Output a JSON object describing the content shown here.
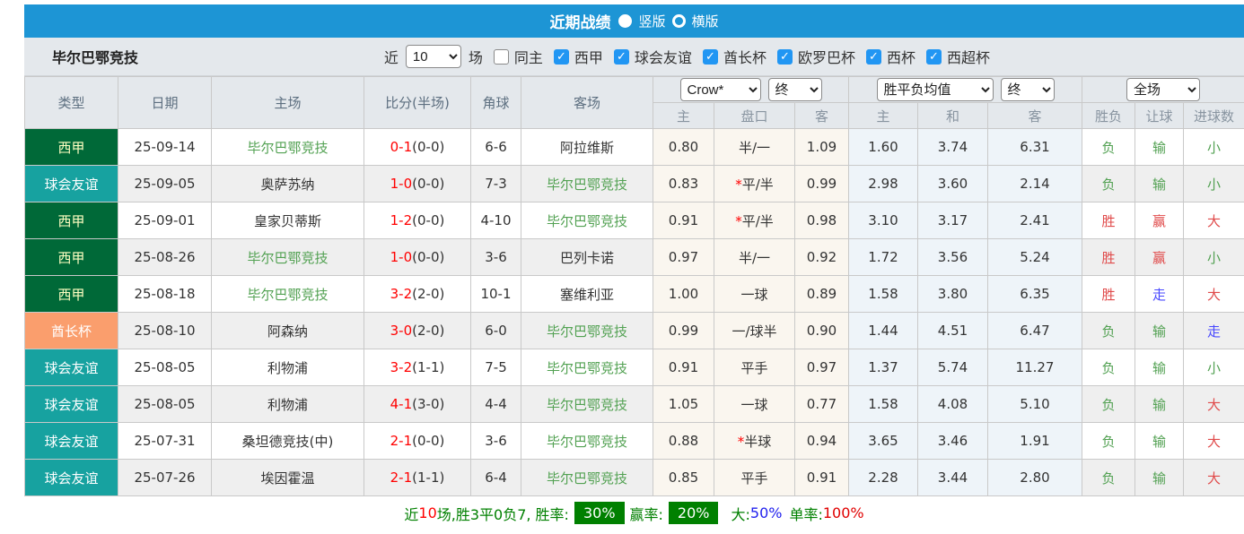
{
  "title_bar": {
    "title": "近期战绩",
    "radio_vertical_label": "竖版",
    "radio_horizontal_label": "横版",
    "selected": "竖版"
  },
  "filter": {
    "team": "毕尔巴鄂竞技",
    "near_label": "近",
    "count_value": "10",
    "games_label": "场",
    "same_home_label": "同主",
    "leagues": [
      "西甲",
      "球会友谊",
      "酋长杯",
      "欧罗巴杯",
      "西杯",
      "西超杯"
    ],
    "leagues_checked": [
      true,
      true,
      true,
      true,
      true,
      true
    ],
    "same_home_checked": false
  },
  "table": {
    "header_row1": [
      "类型",
      "日期",
      "主场",
      "比分(半场)",
      "角球",
      "客场"
    ],
    "selects": {
      "odds_company": "Crow*",
      "odds_time1": "终",
      "avg_mode": "胜平负均值",
      "odds_time2": "终",
      "scope": "全场"
    },
    "header_row2": [
      "主",
      "盘口",
      "客",
      "主",
      "和",
      "客",
      "胜负",
      "让球",
      "进球数"
    ],
    "rows": [
      {
        "type": "西甲",
        "type_class": "liga",
        "date": "25-09-14",
        "home": "毕尔巴鄂竞技",
        "home_self": true,
        "score": "0-1",
        "half": "(0-0)",
        "corners": "6-6",
        "away": "阿拉维斯",
        "away_self": false,
        "odds_home": "0.80",
        "star": false,
        "handicap": "半/一",
        "odds_away": "1.09",
        "avg_home": "1.60",
        "avg_draw": "3.74",
        "avg_away": "6.31",
        "result": "负",
        "result_c": "green",
        "let": "输",
        "let_c": "green",
        "goal": "小",
        "goal_c": "green"
      },
      {
        "type": "球会友谊",
        "type_class": "friendly",
        "date": "25-09-05",
        "home": "奥萨苏纳",
        "home_self": false,
        "score": "1-0",
        "half": "(0-0)",
        "corners": "7-3",
        "away": "毕尔巴鄂竞技",
        "away_self": true,
        "odds_home": "0.83",
        "star": true,
        "handicap": "平/半",
        "odds_away": "0.99",
        "avg_home": "2.98",
        "avg_draw": "3.60",
        "avg_away": "2.14",
        "result": "负",
        "result_c": "green",
        "let": "输",
        "let_c": "green",
        "goal": "小",
        "goal_c": "green"
      },
      {
        "type": "西甲",
        "type_class": "liga",
        "date": "25-09-01",
        "home": "皇家贝蒂斯",
        "home_self": false,
        "score": "1-2",
        "half": "(0-0)",
        "corners": "4-10",
        "away": "毕尔巴鄂竞技",
        "away_self": true,
        "odds_home": "0.91",
        "star": true,
        "handicap": "平/半",
        "odds_away": "0.98",
        "avg_home": "3.10",
        "avg_draw": "3.17",
        "avg_away": "2.41",
        "result": "胜",
        "result_c": "red",
        "let": "赢",
        "let_c": "red",
        "goal": "大",
        "goal_c": "red"
      },
      {
        "type": "西甲",
        "type_class": "liga",
        "date": "25-08-26",
        "home": "毕尔巴鄂竞技",
        "home_self": true,
        "score": "1-0",
        "half": "(0-0)",
        "corners": "3-6",
        "away": "巴列卡诺",
        "away_self": false,
        "odds_home": "0.97",
        "star": false,
        "handicap": "半/一",
        "odds_away": "0.92",
        "avg_home": "1.72",
        "avg_draw": "3.56",
        "avg_away": "5.24",
        "result": "胜",
        "result_c": "red",
        "let": "赢",
        "let_c": "red",
        "goal": "小",
        "goal_c": "green"
      },
      {
        "type": "西甲",
        "type_class": "liga",
        "date": "25-08-18",
        "home": "毕尔巴鄂竞技",
        "home_self": true,
        "score": "3-2",
        "half": "(2-0)",
        "corners": "10-1",
        "away": "塞维利亚",
        "away_self": false,
        "odds_home": "1.00",
        "star": false,
        "handicap": "一球",
        "odds_away": "0.89",
        "avg_home": "1.58",
        "avg_draw": "3.80",
        "avg_away": "6.35",
        "result": "胜",
        "result_c": "red",
        "let": "走",
        "let_c": "blue",
        "goal": "大",
        "goal_c": "red"
      },
      {
        "type": "酋长杯",
        "type_class": "emirates",
        "date": "25-08-10",
        "home": "阿森纳",
        "home_self": false,
        "score": "3-0",
        "half": "(2-0)",
        "corners": "6-0",
        "away": "毕尔巴鄂竞技",
        "away_self": true,
        "odds_home": "0.99",
        "star": false,
        "handicap": "一/球半",
        "odds_away": "0.90",
        "avg_home": "1.44",
        "avg_draw": "4.51",
        "avg_away": "6.47",
        "result": "负",
        "result_c": "green",
        "let": "输",
        "let_c": "green",
        "goal": "走",
        "goal_c": "blue"
      },
      {
        "type": "球会友谊",
        "type_class": "friendly",
        "date": "25-08-05",
        "home": "利物浦",
        "home_self": false,
        "score": "3-2",
        "half": "(1-1)",
        "corners": "7-5",
        "away": "毕尔巴鄂竞技",
        "away_self": true,
        "odds_home": "0.91",
        "star": false,
        "handicap": "平手",
        "odds_away": "0.97",
        "avg_home": "1.37",
        "avg_draw": "5.74",
        "avg_away": "11.27",
        "result": "负",
        "result_c": "green",
        "let": "输",
        "let_c": "green",
        "goal": "小",
        "goal_c": "green"
      },
      {
        "type": "球会友谊",
        "type_class": "friendly",
        "date": "25-08-05",
        "home": "利物浦",
        "home_self": false,
        "score": "4-1",
        "half": "(3-0)",
        "corners": "4-4",
        "away": "毕尔巴鄂竞技",
        "away_self": true,
        "odds_home": "1.05",
        "star": false,
        "handicap": "一球",
        "odds_away": "0.77",
        "avg_home": "1.58",
        "avg_draw": "4.08",
        "avg_away": "5.10",
        "result": "负",
        "result_c": "green",
        "let": "输",
        "let_c": "green",
        "goal": "大",
        "goal_c": "red"
      },
      {
        "type": "球会友谊",
        "type_class": "friendly",
        "date": "25-07-31",
        "home": "桑坦德竞技(中)",
        "home_self": false,
        "score": "2-1",
        "half": "(0-0)",
        "corners": "3-6",
        "away": "毕尔巴鄂竞技",
        "away_self": true,
        "odds_home": "0.88",
        "star": true,
        "handicap": "半球",
        "odds_away": "0.94",
        "avg_home": "3.65",
        "avg_draw": "3.46",
        "avg_away": "1.91",
        "result": "负",
        "result_c": "green",
        "let": "输",
        "let_c": "green",
        "goal": "大",
        "goal_c": "red"
      },
      {
        "type": "球会友谊",
        "type_class": "friendly",
        "date": "25-07-26",
        "home": "埃因霍温",
        "home_self": false,
        "score": "2-1",
        "half": "(1-1)",
        "corners": "6-4",
        "away": "毕尔巴鄂竞技",
        "away_self": true,
        "odds_home": "0.85",
        "star": false,
        "handicap": "平手",
        "odds_away": "0.91",
        "avg_home": "2.28",
        "avg_draw": "3.44",
        "avg_away": "2.80",
        "result": "负",
        "result_c": "green",
        "let": "输",
        "let_c": "green",
        "goal": "大",
        "goal_c": "red"
      }
    ]
  },
  "summary": {
    "near_label": "近",
    "count": "10",
    "record_text": "场,胜3平0负7, 胜率:",
    "win_rate": "30%",
    "handicap_label": "赢率:",
    "handicap_rate": "20%",
    "big_label": "大:",
    "big_rate": "50%",
    "single_label": "单率:",
    "single_rate": "100%"
  },
  "colors": {
    "header_blue": "#1d95d5",
    "bar_gray": "#e4e8ec",
    "liga_green": "#006938",
    "friendly_teal": "#17a2a0",
    "emirates_orange": "#fa9e6d",
    "win_red": "#e04a4a",
    "loss_green": "#52a152",
    "push_blue": "#4848ff",
    "badge_green": "#008000",
    "checkbox_blue": "#2196f3"
  }
}
